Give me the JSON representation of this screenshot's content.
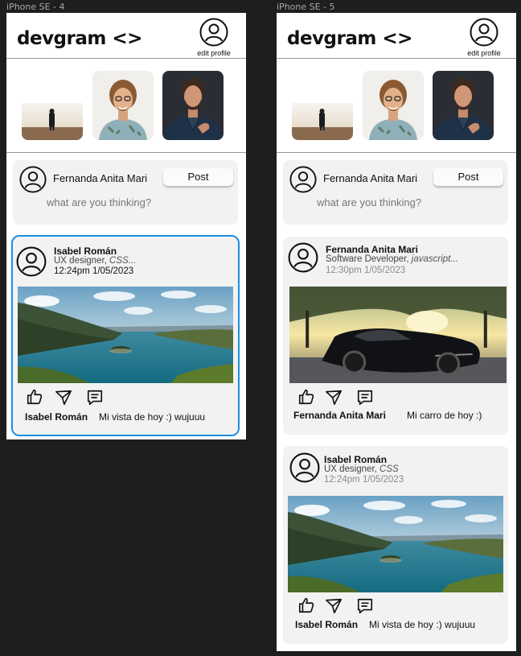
{
  "frames": [
    {
      "label": "iPhone SE - 4",
      "header": {
        "logo": "devgram",
        "logo_code": "<>",
        "edit_profile": "edit profile"
      },
      "composer": {
        "name": "Fernanda Anita Mari",
        "post_button": "Post",
        "placeholder": "what are you thinking?"
      },
      "posts": [
        {
          "name": "Isabel Román",
          "role": "UX designer, ",
          "tag": "CSS...",
          "time": "12:24pm 1/05/2023",
          "caption_name": "Isabel Román",
          "caption": "Mi vista de hoy :) wujuuu"
        }
      ]
    },
    {
      "label": "iPhone SE - 5",
      "header": {
        "logo": "devgram",
        "logo_code": "<>",
        "edit_profile": "edit profile"
      },
      "composer": {
        "name": "Fernanda Anita Mari",
        "post_button": "Post",
        "placeholder": "what are you thinking?"
      },
      "posts": [
        {
          "name": "Fernanda Anita Mari",
          "role": "Software Developer, ",
          "tag": "javascript...",
          "time": "12:30pm 1/05/2023",
          "caption_name": "Fernanda Anita Mari",
          "caption": "Mi carro de hoy :)"
        },
        {
          "name": "Isabel Román",
          "role": "UX designer, ",
          "tag": "CSS",
          "time": "12:24pm 1/05/2023",
          "caption_name": "Isabel Román",
          "caption": "Mi vista de hoy :) wujuuu"
        }
      ]
    }
  ]
}
